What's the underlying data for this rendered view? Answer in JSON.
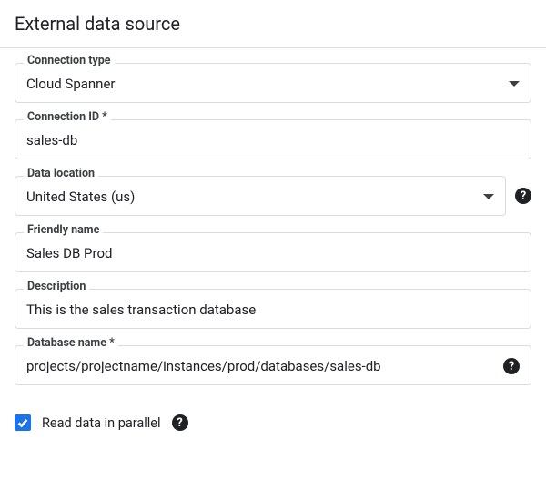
{
  "header": {
    "title": "External data source"
  },
  "fields": {
    "connection_type": {
      "label": "Connection type",
      "value": "Cloud Spanner"
    },
    "connection_id": {
      "label": "Connection ID *",
      "value": "sales-db"
    },
    "data_location": {
      "label": "Data location",
      "value": "United States (us)"
    },
    "friendly_name": {
      "label": "Friendly name",
      "value": "Sales DB Prod"
    },
    "description": {
      "label": "Description",
      "value": "This is the sales transaction database"
    },
    "database_name": {
      "label": "Database name *",
      "value": "projects/projectname/instances/prod/databases/sales-db"
    }
  },
  "parallel": {
    "label": "Read data in parallel",
    "checked": true
  }
}
